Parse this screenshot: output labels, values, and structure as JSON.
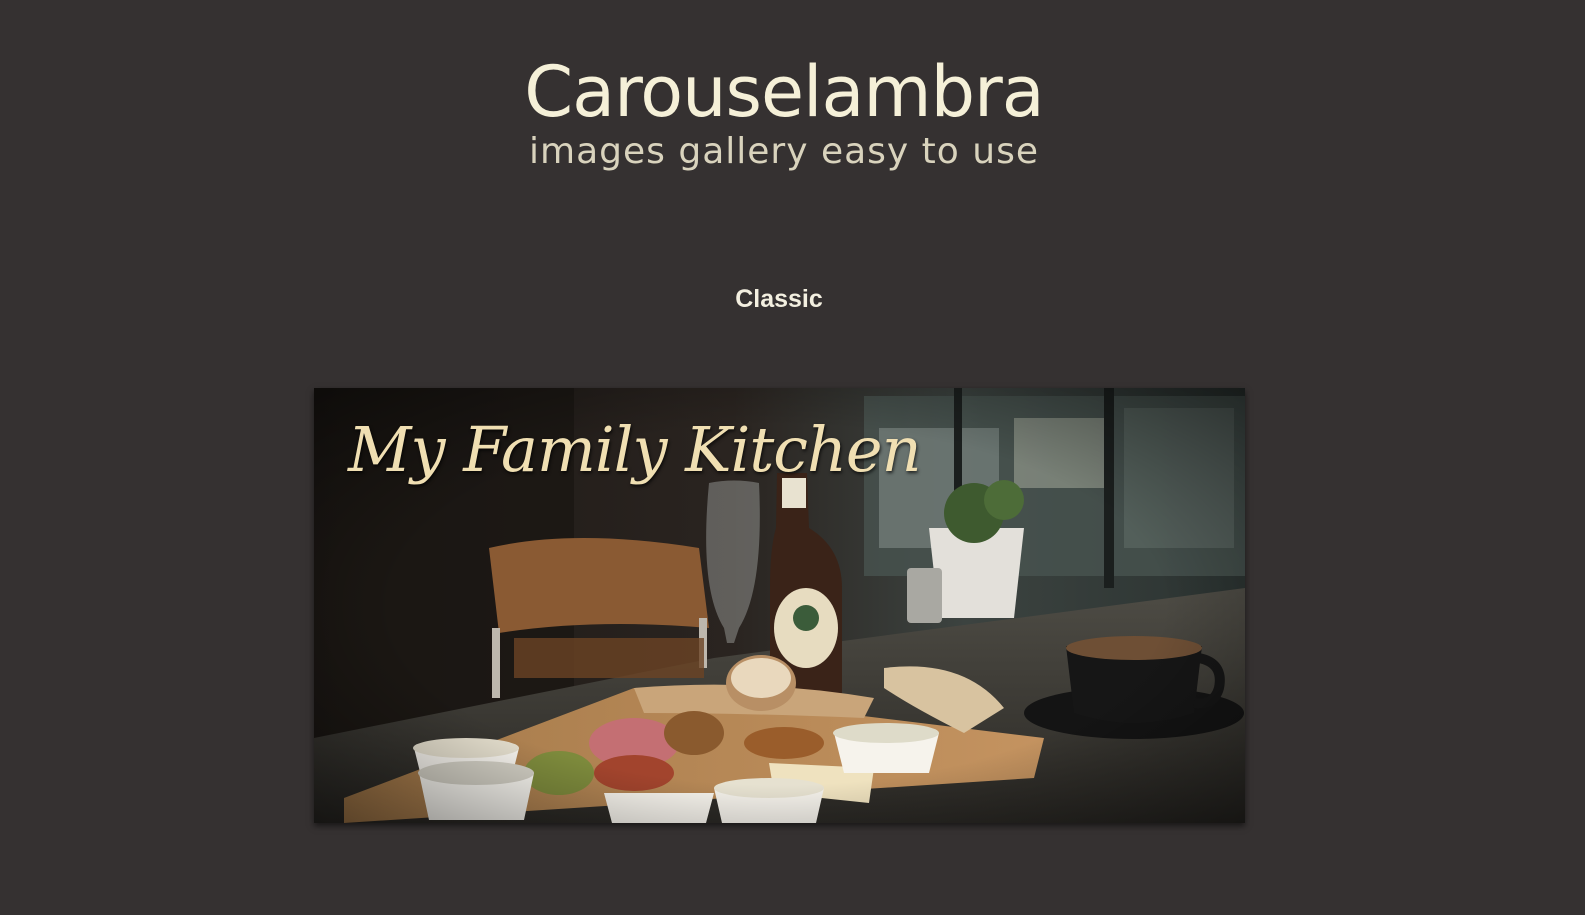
{
  "header": {
    "title": "Carouselambra",
    "subtitle": "images gallery easy to use"
  },
  "section": {
    "title": "Classic"
  },
  "carousel": {
    "slides": [
      {
        "caption": "My Family Kitchen",
        "image": "photo of a café table with a bread and charcuterie board, a beer bottle, an empty glass and a cup of coffee"
      }
    ],
    "active_index": 0
  },
  "colors": {
    "background": "#353131",
    "title": "#f5f0d8",
    "subtitle": "#d9d3bd",
    "caption": "#f0dfb2"
  }
}
